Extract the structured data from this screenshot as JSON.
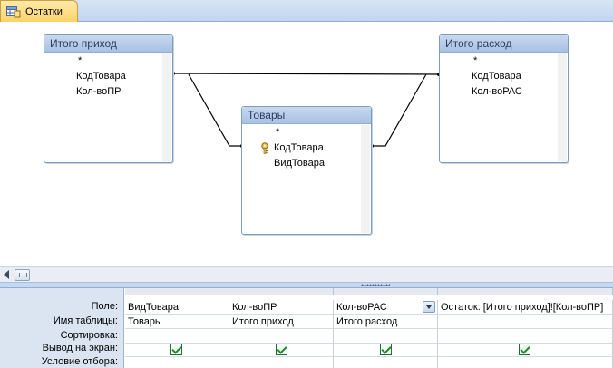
{
  "document_tab": {
    "label": "Остатки",
    "icon": "query-icon"
  },
  "tables": [
    {
      "title": "Итого приход",
      "fields": [
        "*",
        "КодТовара",
        "Кол-воПР"
      ]
    },
    {
      "title": "Товары",
      "fields": [
        "*",
        "КодТовара",
        "ВидТовара"
      ],
      "primary_key_field": "КодТовара"
    },
    {
      "title": "Итого расход",
      "fields": [
        "*",
        "КодТовара",
        "Кол-воРАС"
      ]
    }
  ],
  "grid": {
    "row_labels": [
      "Поле:",
      "Имя таблицы:",
      "Сортировка:",
      "Вывод на экран:",
      "Условие отбора:"
    ],
    "columns": [
      {
        "field": "ВидТовара",
        "table": "Товары",
        "sort": "",
        "show": true,
        "criteria": ""
      },
      {
        "field": "Кол-воПР",
        "table": "Итого приход",
        "sort": "",
        "show": true,
        "criteria": ""
      },
      {
        "field": "Кол-воРАС",
        "table": "Итого расход",
        "sort": "",
        "show": true,
        "criteria": "",
        "has_dropdown": true
      },
      {
        "field": "Остаток: [Итого приход]![Кол-воПР]",
        "table": "",
        "sort": "",
        "show": true,
        "criteria": ""
      }
    ]
  },
  "colors": {
    "tab_background": "#fbd36b",
    "header": "#a9c1e3",
    "checkbox": "#1f8a2a"
  }
}
